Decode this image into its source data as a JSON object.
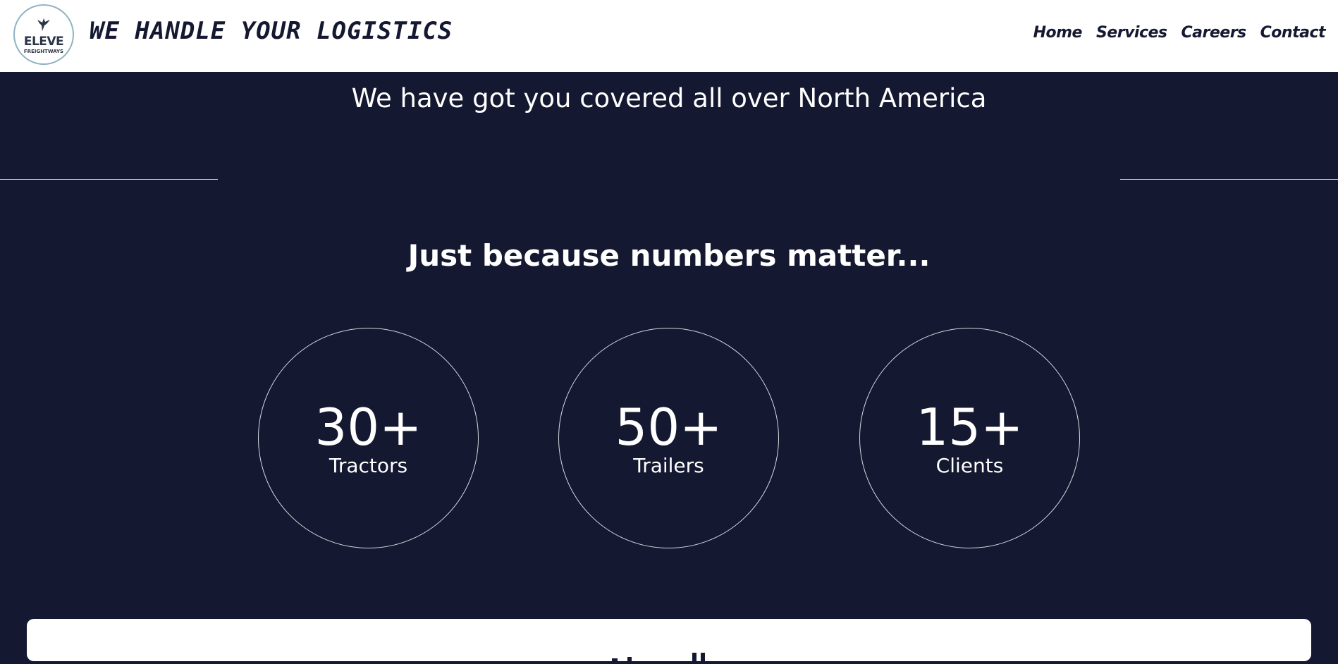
{
  "header": {
    "logo": {
      "word": "ELEVE",
      "sub": "FREIGHTWAYS",
      "icon": "bird-icon"
    },
    "tagline": "WE HANDLE YOUR LOGISTICS",
    "nav": [
      "Home",
      "Services",
      "Careers",
      "Contact"
    ]
  },
  "main": {
    "subtitle": "We have got you covered all over North America",
    "section_title": "Just because numbers matter...",
    "stats": [
      {
        "value": "30+",
        "label": "Tractors"
      },
      {
        "value": "50+",
        "label": "Trailers"
      },
      {
        "value": "15+",
        "label": "Clients"
      }
    ]
  },
  "colors": {
    "background": "#141830",
    "header_bg": "#ffffff",
    "text_light": "#ffffff",
    "text_dark": "#141830",
    "logo_ring": "#8fb3c0"
  }
}
